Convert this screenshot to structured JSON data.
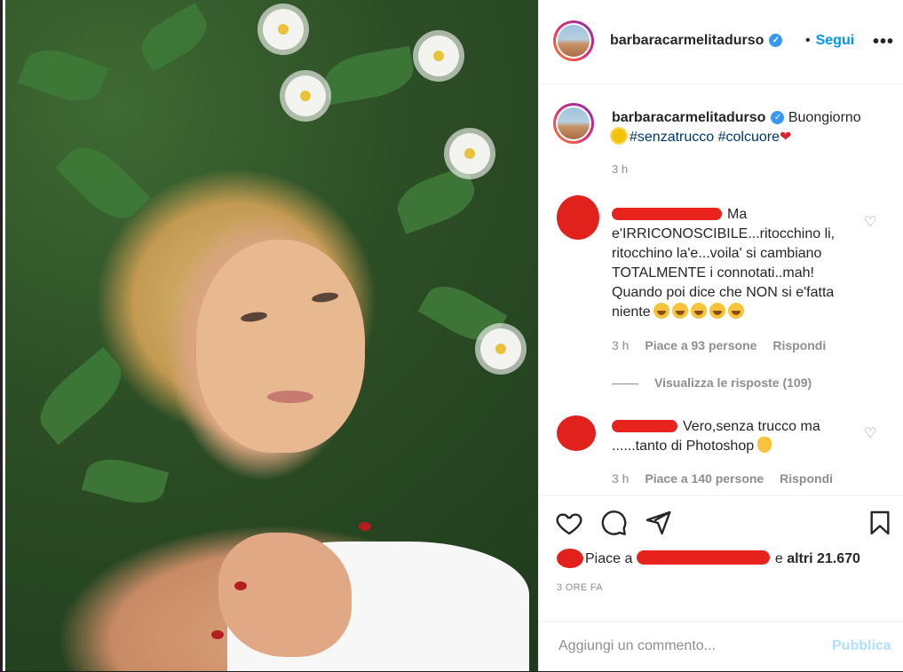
{
  "post": {
    "username": "barbaracarmelitadurso",
    "follow_label": "Segui",
    "separator": "•",
    "more_label": "•••",
    "caption_text": "Buongiorno",
    "hashtags": "#senzatrucco #colcuore",
    "caption_time": "3 h",
    "likes_prefix": "Piace a",
    "likes_suffix": "e",
    "likes_count": "altri 21.670",
    "date": "3 ORE FA",
    "add_comment_placeholder": "Aggiungi un commento...",
    "publish_label": "Pubblica"
  },
  "comments": [
    {
      "text": "Ma e'IRRICONOSCIBILE...ritocchino li, ritocchino la'e...voila' si cambiano TOTALMENTE i connotati..mah! Quando poi dice che NON si e'fatta niente",
      "time": "3 h",
      "likes": "Piace a 93 persone",
      "reply": "Rispondi",
      "view_replies": "Visualizza le risposte (109)"
    },
    {
      "text": "Vero,senza trucco ma ......tanto di Photoshop",
      "time": "3 h",
      "likes": "Piace a 140 persone",
      "reply": "Rispondi"
    }
  ],
  "icons": {
    "like": "heart-icon",
    "comment": "comment-icon",
    "share": "send-icon",
    "save": "bookmark-icon",
    "verified": "verified-badge-icon",
    "more": "more-options-icon"
  },
  "colors": {
    "link_blue": "#0095f6",
    "hashtag": "#00376b",
    "muted": "#8e8e8e",
    "redaction": "#e8231e"
  }
}
